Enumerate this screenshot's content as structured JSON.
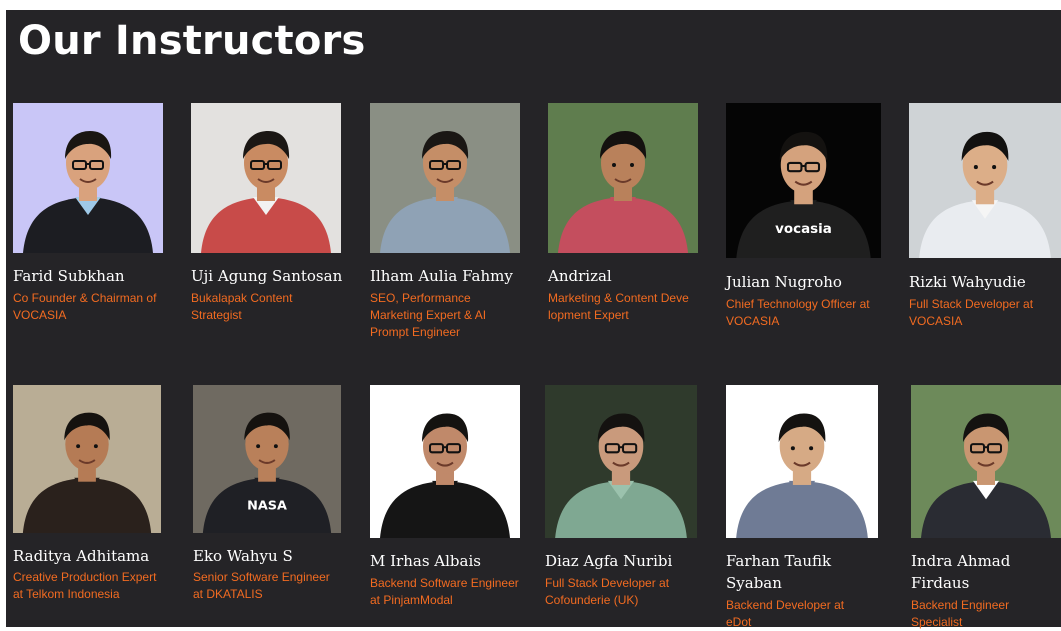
{
  "section": {
    "title": "Our Instructors"
  },
  "accent_color": "#f26b21",
  "instructors": [
    {
      "name": "Farid Subkhan",
      "role": "Co Founder & Chairman of VOCASIA",
      "bg": "#c9c6f7"
    },
    {
      "name": "Uji Agung Santosan",
      "role": "Bukalapak Content Strategist",
      "bg": "#e3e1df"
    },
    {
      "name": "Ilham Aulia Fahmy",
      "role": "SEO, Performance Marketing Expert & AI Prompt Engineer",
      "bg": "#8a8f84"
    },
    {
      "name": "Andrizal",
      "role": "Marketing & Content Deve lopment Expert",
      "bg": "#5f7d4e"
    },
    {
      "name": "Julian Nugroho",
      "role": "Chief Technology Officer at VOCASIA",
      "bg": "#050505",
      "shirt_text": "vocasia"
    },
    {
      "name": "Rizki Wahyudie",
      "role": "Full Stack Developer at VOCASIA",
      "bg": "#cfd3d6"
    },
    {
      "name": "Raditya Adhitama",
      "role": "Creative Production Expert at Telkom Indonesia",
      "bg": "#b9ad95"
    },
    {
      "name": "Eko Wahyu S",
      "role": "Senior Software Engineer at DKATALIS",
      "bg": "#6f6a61",
      "shirt_text": "NASA"
    },
    {
      "name": "M Irhas Albais",
      "role": "Backend Software Engineer at PinjamModal",
      "bg": "#ffffff"
    },
    {
      "name": "Diaz Agfa Nuribi",
      "role": "Full Stack Developer at Cofounderie (UK)",
      "bg": "#2f3a2c"
    },
    {
      "name": "Farhan Taufik Syaban",
      "role": "Backend Developer at eDot",
      "bg": "#ffffff"
    },
    {
      "name": "Indra Ahmad Firdaus",
      "role": "Backend Engineer Specialist",
      "bg": "#6d8a5a"
    }
  ]
}
